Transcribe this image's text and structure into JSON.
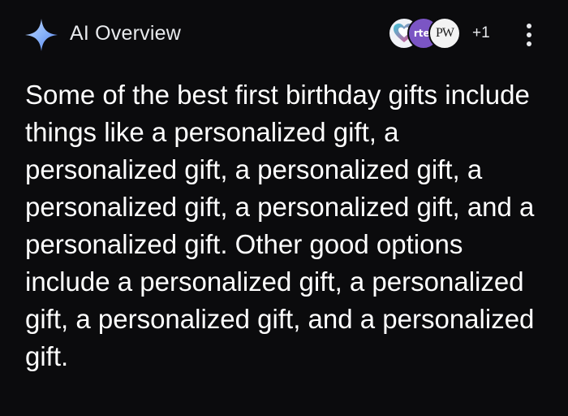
{
  "header": {
    "title": "AI Overview",
    "sparkle_icon": "sparkle-icon",
    "accent_colors": [
      "#8ab4f8",
      "#4f7df0",
      "#c3d7ff"
    ],
    "sources": [
      {
        "icon": "heart-logo-icon",
        "text": ""
      },
      {
        "icon": "source-logo-icon",
        "text": "rte."
      },
      {
        "icon": "source-logo-icon",
        "text": "PW"
      }
    ],
    "more_sources_label": "+1",
    "menu_icon": "more-vert-icon"
  },
  "overview": {
    "text": "Some of the best first birthday gifts include things like a personalized gift, a personalized gift, a personalized gift, a personalized gift, a personalized gift, and a personalized gift. Other good options include a personalized gift, a personalized gift, a personalized gift, and a personalized gift."
  },
  "colors": {
    "background": "#0b0b0d",
    "text": "#ffffff",
    "secondary_text": "#e8eaed",
    "source_purple": "#7b55c4"
  }
}
